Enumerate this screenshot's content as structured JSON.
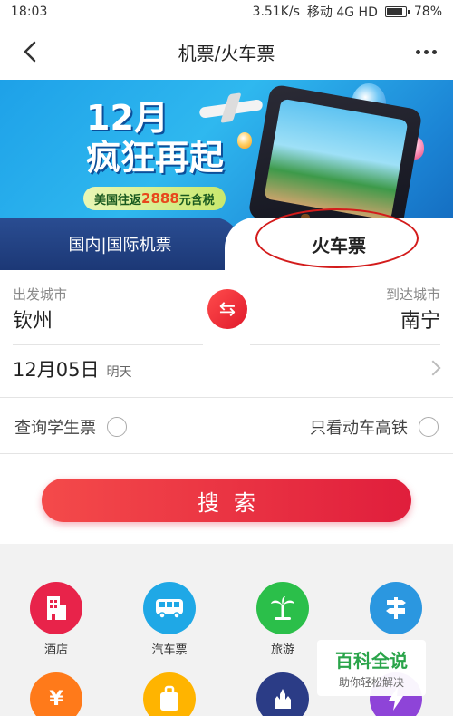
{
  "status": {
    "time": "18:03",
    "speed": "3.51K/s",
    "carrier": "移动 4G HD",
    "battery": "78%"
  },
  "header": {
    "title": "机票/火车票"
  },
  "banner": {
    "line1": "12月",
    "line2": "疯狂再起",
    "promo_prefix": "美国往返",
    "promo_price": "2888",
    "promo_suffix": "元含税"
  },
  "tabs": {
    "flight": "国内|国际机票",
    "train": "火车票"
  },
  "form": {
    "from_label": "出发城市",
    "from_city": "钦州",
    "to_label": "到达城市",
    "to_city": "南宁",
    "date": "12月05日",
    "weekday": "明天",
    "option_student": "查询学生票",
    "option_highspeed": "只看动车高铁",
    "search_label": "搜索"
  },
  "services": [
    {
      "label": "酒店",
      "icon": "hotel-icon",
      "color": "#e8234a"
    },
    {
      "label": "汽车票",
      "icon": "bus-icon",
      "color": "#1fa8e6"
    },
    {
      "label": "旅游",
      "icon": "palm-tree-icon",
      "color": "#2bbf4a"
    },
    {
      "label": "",
      "icon": "signpost-icon",
      "color": "#2b97e0"
    },
    {
      "label": "",
      "icon": "ticket-icon",
      "color": "#ff7a1a"
    },
    {
      "label": "",
      "icon": "luggage-icon",
      "color": "#ffb400"
    },
    {
      "label": "",
      "icon": "disney-icon",
      "color": "#2b3c86"
    },
    {
      "label": "",
      "icon": "flash-icon",
      "color": "#8e44d8"
    }
  ],
  "watermark": {
    "title": "百科全说",
    "subtitle": "助你轻松解决"
  }
}
